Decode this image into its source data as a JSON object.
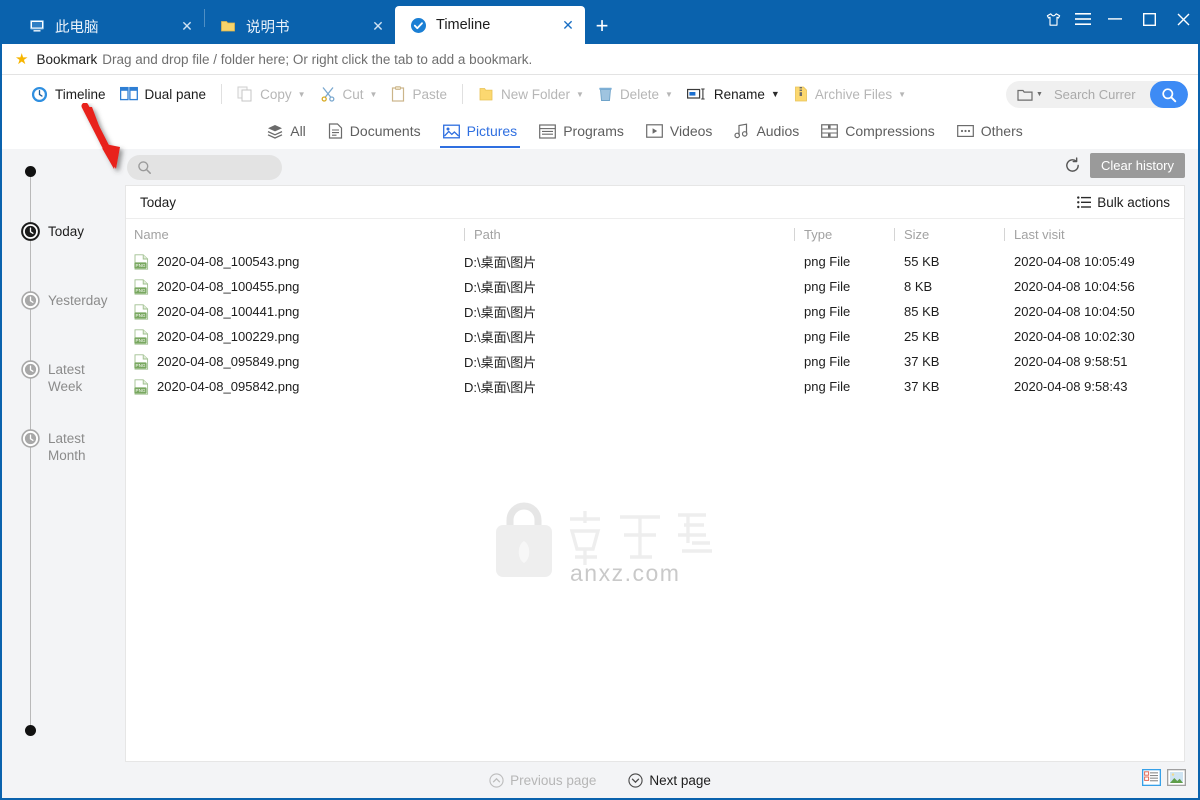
{
  "window": {
    "tabs": [
      {
        "label": "此电脑",
        "icon": "computer-icon",
        "active": false
      },
      {
        "label": "说明书",
        "icon": "folder-icon",
        "active": false
      },
      {
        "label": "Timeline",
        "icon": "timeline-shield-icon",
        "active": true
      }
    ],
    "new_tab_label": "+",
    "controls": {
      "shirt": "shirt-icon",
      "menu": "hamburger-menu-icon",
      "minimize": "minimize-icon",
      "maximize": "maximize-icon",
      "close": "close-icon"
    }
  },
  "bookmark_bar": {
    "title": "Bookmark",
    "hint": "Drag and drop file / folder here; Or right click the tab to add a bookmark."
  },
  "toolbar": {
    "items": [
      {
        "label": "Timeline",
        "icon": "clock-icon",
        "enabled": true,
        "caret": false
      },
      {
        "label": "Dual pane",
        "icon": "dualpane-icon",
        "enabled": true,
        "caret": false
      },
      {
        "label": "Copy",
        "icon": "copy-icon",
        "enabled": false,
        "caret": true
      },
      {
        "label": "Cut",
        "icon": "scissors-icon",
        "enabled": false,
        "caret": true
      },
      {
        "label": "Paste",
        "icon": "clipboard-icon",
        "enabled": false,
        "caret": false
      },
      {
        "label": "New Folder",
        "icon": "new-folder-icon",
        "enabled": false,
        "caret": true
      },
      {
        "label": "Delete",
        "icon": "trash-icon",
        "enabled": false,
        "caret": true
      },
      {
        "label": "Rename",
        "icon": "rename-icon",
        "enabled": true,
        "caret": true
      },
      {
        "label": "Archive Files",
        "icon": "archive-icon",
        "enabled": false,
        "caret": true
      }
    ],
    "search": {
      "placeholder": "Search Currer",
      "value": "",
      "scope_icon": "folder-scope-icon",
      "go_icon": "search-icon"
    }
  },
  "category_tabs": [
    {
      "label": "All",
      "icon": "layers-icon",
      "active": false
    },
    {
      "label": "Documents",
      "icon": "document-icon",
      "active": false
    },
    {
      "label": "Pictures",
      "icon": "picture-icon",
      "active": true
    },
    {
      "label": "Programs",
      "icon": "program-icon",
      "active": false
    },
    {
      "label": "Videos",
      "icon": "video-icon",
      "active": false
    },
    {
      "label": "Audios",
      "icon": "audio-icon",
      "active": false
    },
    {
      "label": "Compressions",
      "icon": "compression-icon",
      "active": false
    },
    {
      "label": "Others",
      "icon": "others-icon",
      "active": false
    }
  ],
  "timeline_rail": [
    {
      "label": "Today",
      "active": true
    },
    {
      "label": "Yesterday",
      "active": false
    },
    {
      "label": "Latest Week",
      "active": false
    },
    {
      "label": "Latest Month",
      "active": false
    }
  ],
  "filter": {
    "placeholder": "",
    "value": "",
    "search_icon": "search-icon",
    "refresh_icon": "refresh-icon",
    "clear_history_label": "Clear history"
  },
  "panel": {
    "group_title": "Today",
    "bulk_actions_label": "Bulk actions",
    "columns": [
      "Name",
      "Path",
      "Type",
      "Size",
      "Last visit"
    ],
    "rows": [
      {
        "name": "2020-04-08_100543.png",
        "path": "D:\\桌面\\图片",
        "type": "png File",
        "size": "55 KB",
        "last_visit": "2020-04-08 10:05:49"
      },
      {
        "name": "2020-04-08_100455.png",
        "path": "D:\\桌面\\图片",
        "type": "png File",
        "size": "8 KB",
        "last_visit": "2020-04-08 10:04:56"
      },
      {
        "name": "2020-04-08_100441.png",
        "path": "D:\\桌面\\图片",
        "type": "png File",
        "size": "85 KB",
        "last_visit": "2020-04-08 10:04:50"
      },
      {
        "name": "2020-04-08_100229.png",
        "path": "D:\\桌面\\图片",
        "type": "png File",
        "size": "25 KB",
        "last_visit": "2020-04-08 10:02:30"
      },
      {
        "name": "2020-04-08_095849.png",
        "path": "D:\\桌面\\图片",
        "type": "png File",
        "size": "37 KB",
        "last_visit": "2020-04-08 9:58:51"
      },
      {
        "name": "2020-04-08_095842.png",
        "path": "D:\\桌面\\图片",
        "type": "png File",
        "size": "37 KB",
        "last_visit": "2020-04-08 9:58:43"
      }
    ]
  },
  "statusbar": {
    "previous_page_label": "Previous page",
    "next_page_label": "Next page",
    "previous_enabled": false,
    "next_enabled": true,
    "view_list_icon": "list-view-icon",
    "view_thumb_icon": "thumbnail-view-icon"
  },
  "watermark": {
    "text": "anxz.com",
    "cjk": "安下载"
  },
  "colors": {
    "titlebar": "#0a62ad",
    "accent": "#2f6fe0",
    "search_button": "#3d8bf5",
    "clear_history": "#9a9a9a",
    "annotation_arrow": "#e8201a"
  }
}
